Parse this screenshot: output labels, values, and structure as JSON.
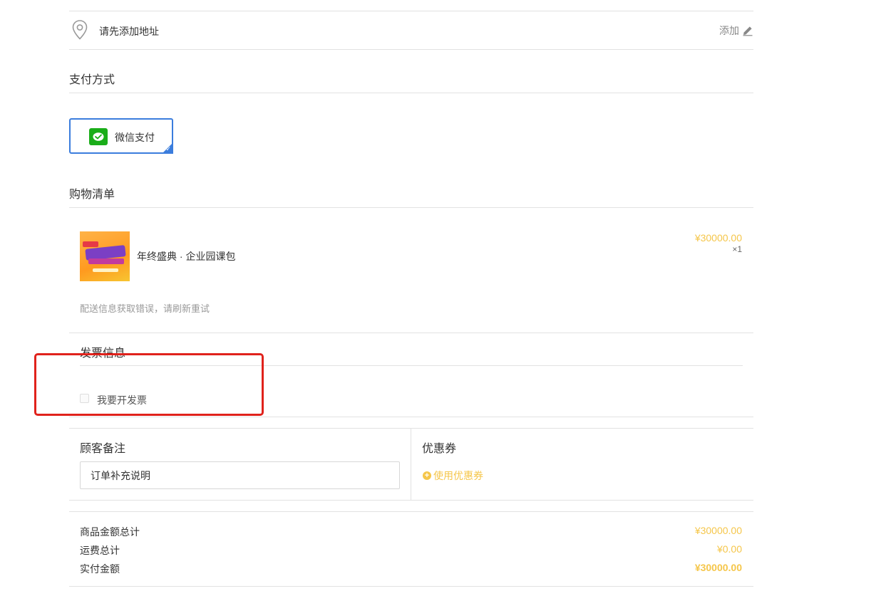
{
  "address": {
    "placeholder_text": "请先添加地址",
    "add_label": "添加"
  },
  "payment": {
    "title": "支付方式",
    "method_label": "微信支付"
  },
  "cart": {
    "title": "购物清单",
    "items": [
      {
        "name": "年终盛典 · 企业园课包",
        "price": "¥30000.00",
        "qty": "×1"
      }
    ],
    "error_message": "配送信息获取错误，请刷新重试"
  },
  "invoice": {
    "title": "发票信息",
    "checkbox_label": "我要开发票"
  },
  "note": {
    "title": "顾客备注",
    "placeholder": "订单补充说明"
  },
  "coupon": {
    "title": "优惠券",
    "use_label": "使用优惠券"
  },
  "totals": {
    "goods_label": "商品金额总计",
    "goods_value": "¥30000.00",
    "shipping_label": "运费总计",
    "shipping_value": "¥0.00",
    "paid_label": "实付金额",
    "paid_value": "¥30000.00"
  },
  "colors": {
    "accent_blue": "#3b7ddd",
    "price_gold": "#f5c64a",
    "wechat_green": "#1aad19",
    "highlight_red": "#e0221c"
  }
}
